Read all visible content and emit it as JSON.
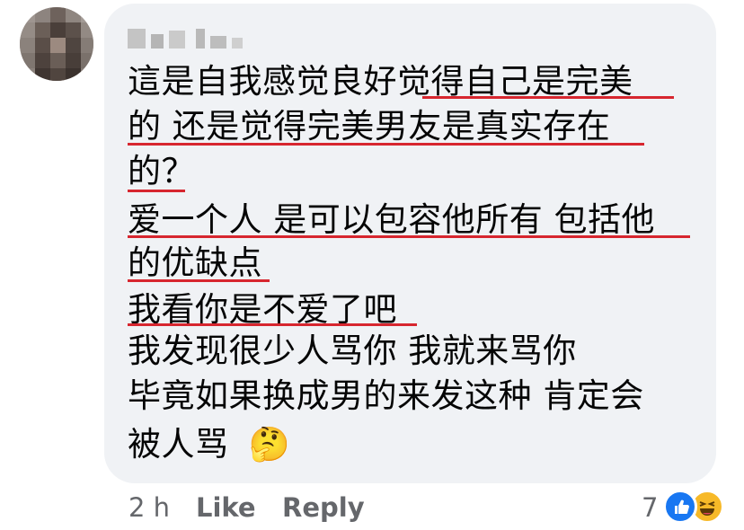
{
  "comment": {
    "lines": [
      "這是自我感觉良好觉得自己是完美",
      "的 还是觉得完美男友是真实存在",
      "的？",
      "爱一个人 是可以包容他所有 包括他",
      "的优缺点",
      "我看你是不爱了吧",
      "我发现很少人骂你 我就来骂你",
      "毕竟如果换成男的来发这种 肯定会",
      "被人骂"
    ],
    "emoji": "🤔"
  },
  "actions": {
    "time": "2 h",
    "like": "Like",
    "reply": "Reply"
  },
  "reactions": {
    "count": "7",
    "icons": [
      "like-icon",
      "haha-icon"
    ]
  },
  "colors": {
    "bubble": "#f0f2f5",
    "underline": "#d7262f",
    "like_blue": "#1877f2",
    "haha_yellow": "#f7b928"
  }
}
